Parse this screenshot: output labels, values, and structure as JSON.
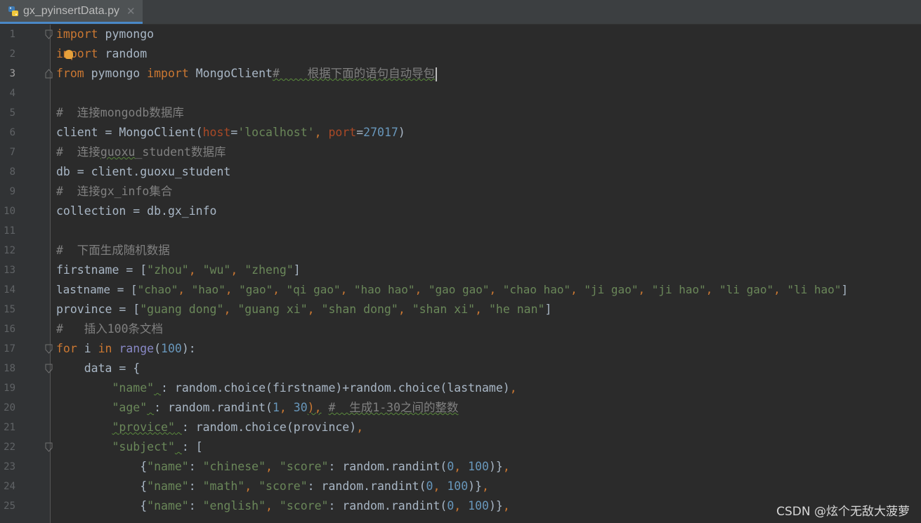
{
  "tab": {
    "filename": "gx_pyinsertData.py",
    "close": "✕"
  },
  "watermark": "CSDN @炫个无敌大菠萝",
  "lines": [
    {
      "n": "1",
      "p": [
        "import",
        " pymongo"
      ]
    },
    {
      "n": "2",
      "p": [
        "i",
        "mport",
        " random"
      ]
    },
    {
      "n": "3",
      "p": [
        "from",
        " pymongo ",
        "import",
        " MongoClient",
        "#    根据下面的语句自动导包"
      ]
    },
    {
      "n": "4"
    },
    {
      "n": "5",
      "p": [
        "#  连接mongodb数据库"
      ]
    },
    {
      "n": "6",
      "p": [
        "client = MongoClient(",
        "host",
        "=",
        "'localhost'",
        ", ",
        "port",
        "=",
        "27017",
        ")"
      ]
    },
    {
      "n": "7",
      "p": [
        "#  连接",
        "guoxu",
        "_student数据库"
      ]
    },
    {
      "n": "8",
      "p": [
        "db = client.guoxu_student"
      ]
    },
    {
      "n": "9",
      "p": [
        "#  连接gx_info集合"
      ]
    },
    {
      "n": "10",
      "p": [
        "collection = db.gx_info"
      ]
    },
    {
      "n": "11"
    },
    {
      "n": "12",
      "p": [
        "#  下面生成随机数据"
      ]
    },
    {
      "n": "13",
      "p": [
        "firstname = [",
        "\"zhou\"",
        ", ",
        "\"wu\"",
        ", ",
        "\"zheng\"",
        "]"
      ]
    },
    {
      "n": "14",
      "p": [
        "lastname = [",
        "\"chao\"",
        ", ",
        "\"hao\"",
        ", ",
        "\"gao\"",
        ", ",
        "\"qi gao\"",
        ", ",
        "\"hao hao\"",
        ", ",
        "\"gao gao\"",
        ", ",
        "\"chao hao\"",
        ", ",
        "\"ji gao\"",
        ", ",
        "\"ji hao\"",
        ", ",
        "\"li gao\"",
        ", ",
        "\"li hao\"",
        "]"
      ]
    },
    {
      "n": "15",
      "p": [
        "province = [",
        "\"guang dong\"",
        ", ",
        "\"guang xi\"",
        ", ",
        "\"shan dong\"",
        ", ",
        "\"shan xi\"",
        ", ",
        "\"he nan\"",
        "]"
      ]
    },
    {
      "n": "16",
      "p": [
        "#   插入100条文档"
      ]
    },
    {
      "n": "17",
      "p": [
        "for",
        " i ",
        "in",
        " ",
        "range",
        "(",
        "100",
        "):"
      ]
    },
    {
      "n": "18",
      "p": [
        "    data = {"
      ]
    },
    {
      "n": "19",
      "p": [
        "        ",
        "\"name\"",
        " ",
        ": random.choice(firstname)+random.choice(lastname)",
        ","
      ]
    },
    {
      "n": "20",
      "p": [
        "        ",
        "\"age\"",
        " ",
        ": random.randint(",
        "1",
        ", ",
        "30",
        "),",
        " ",
        "#  生成1-30之间的整数"
      ]
    },
    {
      "n": "21",
      "p": [
        "        ",
        "\"provice\"",
        " ",
        ": random.choice(province)",
        ","
      ]
    },
    {
      "n": "22",
      "p": [
        "        ",
        "\"subject\"",
        " ",
        ": ["
      ]
    },
    {
      "n": "23",
      "p": [
        "            {",
        "\"name\"",
        ": ",
        "\"chinese\"",
        ", ",
        "\"score\"",
        ": random.randint(",
        "0",
        ", ",
        "100",
        ")}",
        ","
      ]
    },
    {
      "n": "24",
      "p": [
        "            {",
        "\"name\"",
        ": ",
        "\"math\"",
        ", ",
        "\"score\"",
        ": random.randint(",
        "0",
        ", ",
        "100",
        ")}",
        ","
      ]
    },
    {
      "n": "25",
      "p": [
        "            {",
        "\"name\"",
        ": ",
        "\"english\"",
        ", ",
        "\"score\"",
        ": random.randint(",
        "0",
        ", ",
        "100",
        ")}",
        ","
      ]
    }
  ]
}
